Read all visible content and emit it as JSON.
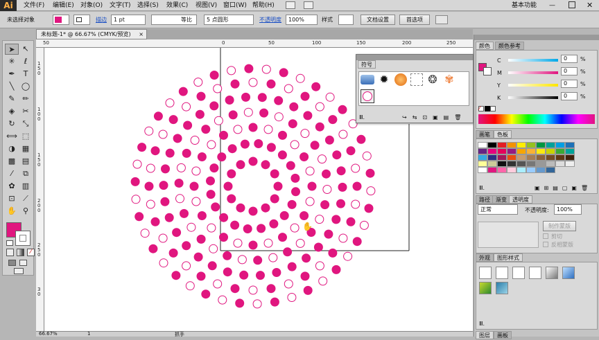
{
  "app": {
    "logo": "Ai",
    "workspace": "基本功能"
  },
  "menu": [
    "文件(F)",
    "编辑(E)",
    "对象(O)",
    "文字(T)",
    "选择(S)",
    "效果(C)",
    "视图(V)",
    "窗口(W)",
    "帮助(H)"
  ],
  "control": {
    "selection": "未选择对象",
    "stroke_label": "描边",
    "stroke_weight": "1 pt",
    "profile": "等比",
    "brush": "5 点圆形",
    "opacity_label": "不透明度",
    "opacity": "100%",
    "style_label": "样式",
    "doc_setup": "文档设置",
    "prefs": "首选项"
  },
  "doc": {
    "tab": "未标题-1* @ 66.67% (CMYK/预览)",
    "zoom": "66.67%",
    "page": "1",
    "status": "抓手"
  },
  "ruler": {
    "h": [
      "50",
      "0",
      "50",
      "100",
      "150",
      "200",
      "250"
    ],
    "v": [
      "1",
      "5",
      "0",
      "1",
      "0",
      "0",
      "1",
      "5",
      "0",
      "2",
      "0",
      "0",
      "2",
      "5",
      "0",
      "3",
      "0"
    ]
  },
  "colors": {
    "accent": "#e0167f",
    "fill": "#e0167f",
    "stroke": "#ffffff"
  },
  "symbols": {
    "title": "符号"
  },
  "color_panel": {
    "tabs": [
      "颜色",
      "颜色参考"
    ],
    "channels": [
      {
        "k": "C",
        "v": "0"
      },
      {
        "k": "M",
        "v": "0"
      },
      {
        "k": "Y",
        "v": "0"
      },
      {
        "k": "K",
        "v": "0"
      }
    ],
    "unit": "%"
  },
  "swatch_panel": {
    "tabs": [
      "画笔",
      "色板"
    ]
  },
  "transparency": {
    "tabs": [
      "路径",
      "渐变",
      "透明度"
    ],
    "mode": "正常",
    "opacity_label": "不透明度:",
    "opacity": "100%",
    "make_mask": "制作蒙版",
    "clip": "剪切",
    "invert": "反相蒙版"
  },
  "styles_panel": {
    "tabs": [
      "外观",
      "图形样式"
    ]
  },
  "bottom_tabs": [
    "图层",
    "画板"
  ],
  "dot_rings": [
    {
      "r": 36,
      "n": 12,
      "p": "f",
      "o": 0
    },
    {
      "r": 62,
      "n": 20,
      "p": "f",
      "o": 0.07
    },
    {
      "r": 85,
      "n": 24,
      "p": "a",
      "o": 0.0
    },
    {
      "r": 107,
      "n": 30,
      "p": "a",
      "o": 0.04
    },
    {
      "r": 129,
      "n": 34,
      "p": "f",
      "o": 0.09
    },
    {
      "r": 150,
      "n": 36,
      "p": "a",
      "o": 0.0
    },
    {
      "r": 170,
      "n": 42,
      "p": "a",
      "o": 0.03
    }
  ]
}
